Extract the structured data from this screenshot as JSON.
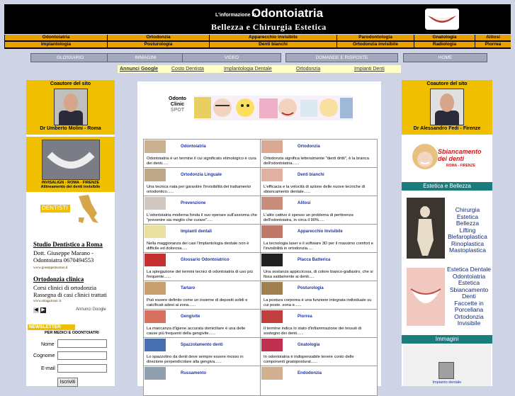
{
  "header": {
    "intro": "L'informazione in",
    "title": "Odontoiatria",
    "subtitle": "Bellezza e Chirurgia Estetica"
  },
  "nav_rows": [
    [
      "Odontoiatria",
      "Ortodonzia",
      "Apparecchio invisibile",
      "Parodontologia",
      "Gnatologia",
      "Alitosi"
    ],
    [
      "Implantologia",
      "Posturologia",
      "Denti bianchi",
      "Ortodonzia invisibile",
      "Radiologia",
      "Piorrea"
    ]
  ],
  "buttons": [
    "GLOSSARIO",
    "IMMAGINI",
    "VIDEO",
    "DOMANDE E RISPOSTE",
    "HOME"
  ],
  "ads": {
    "google": "Annunci Google",
    "links": [
      "Costo Dentista",
      "Implantologia Dentale",
      "Ortodonzia",
      "Impianti Denti"
    ]
  },
  "left": {
    "sponsor_title": "Coautore del sito",
    "sponsor_name": "Dr Umberto Molini - Roma",
    "invisalign_caption": "INVISALIGN - ROMA - FIRENZE\nAllineamento dei denti invisibile",
    "dentisti_label": "DENTISTI",
    "ad1_title": "Studio Dentistico a Roma",
    "ad1_text": "Dott. Giuseppe Marano - Odontoiatra 0670494553",
    "ad1_url": "www.giuseppemarano.it",
    "ad2_title": "Ortodonzia clinica",
    "ad2_text": "Corsi clinici di ortodonzia Rassegna di casi clinici trattati",
    "ad2_url": "www.smagalrosic.it",
    "google_ads": "Annunci Google",
    "newsletter": "NEWSLETTER",
    "newsletter_sub": "PER MEDICI E ODONTOIATRI",
    "field_labels": [
      "Nome",
      "Cognome",
      "E-mail"
    ],
    "submit": "Iscriviti"
  },
  "banner": {
    "word1": "Odonto",
    "word2": "Clinic",
    "word3": "SPOT"
  },
  "cards": [
    {
      "title": "Odontoiatria",
      "text": "Odontoiatria è un termine il cui significato etimologico è cura dei denti.....",
      "thumb": "#c9b08e"
    },
    {
      "title": "Ortodonzia",
      "text": "Ortodonzia significa letteralmente \"denti dritti\", è la branca dell'odontoiatria......",
      "thumb": "#d8a890"
    },
    {
      "title": "Ortodonzia Linguale",
      "text": "Una tecnica nata per garantire l'invisibilità del trattamento ortodontico......",
      "thumb": "#bfa88a"
    },
    {
      "title": "Denti bianchi",
      "text": "L'efficacia e la velocità di azione delle nuove tecniche di sbiancamento dentale......",
      "thumb": "#e0b0a0"
    },
    {
      "title": "Prevenzione",
      "text": "L'odontoiatria moderna fonda il suo operare sull'assioma che \"prevenire sia meglio che curare\".....",
      "thumb": "#d0c8c0"
    },
    {
      "title": "Alitosi",
      "text": "L'alito cattivo è spesso un problema di pertinenza dell'odontoiatra, in circa il 90%.....",
      "thumb": "#c88c7a"
    },
    {
      "title": "Impianti dentali",
      "text": "Nella maggioranza dei casi l'implantologia dentale non è difficile ed dolorosa.....",
      "thumb": "#e8e0a0"
    },
    {
      "title": "Apparecchio Invisibile",
      "text": "La tecnologia laser e il software 3D per il massimo comfort e l'invisibilità in ortodonzia.....",
      "thumb": "#c07868"
    },
    {
      "title": "Glossario Odontoiatrico",
      "text": "La spiegazione dei termini tecnici di odontoiatria di uso più frequente......",
      "thumb": "#c43030"
    },
    {
      "title": "Placca Batterica",
      "text": "Una sostanza appiccicosa, di colore bianco-giallastro, che si fissa saldamente ai denti.....",
      "thumb": "#202020"
    },
    {
      "title": "Tartaro",
      "text": "Può essere definito come un insieme di depositi solidi e calcificati adesi ai zona......",
      "thumb": "#c8a070"
    },
    {
      "title": "Posturologia",
      "text": "La postura corporea è una funzione integrata individuale su cui poste. sona e......",
      "thumb": "#a08050"
    },
    {
      "title": "Gengivite",
      "text": "La mancanza d'igiene accurata domiciliare è una delle cause più frequenti della gengivite......",
      "thumb": "#d87060"
    },
    {
      "title": "Piorrea",
      "text": "Il termine indica lo stato d'infiammazione dei tessuti di sostegno dei denti......",
      "thumb": "#c04040"
    },
    {
      "title": "Spazzolamento denti",
      "text": "Lo spazzolino da denti deve sempre essere mosso in direzione perpendicolare alla gengiva......",
      "thumb": "#4870b0"
    },
    {
      "title": "Gnatologia",
      "text": "In odontoiatria è indispensabile tenere conto delle componenti gnatopostural......",
      "thumb": "#c03050"
    },
    {
      "title": "Russamento",
      "text": "",
      "thumb": "#90a0b0"
    },
    {
      "title": "Endodonzia",
      "text": "",
      "thumb": "#d0b090"
    }
  ],
  "right": {
    "sponsor_title": "Coautore del sito",
    "sponsor_name": "Dr Alessandro Fedi - Firenze",
    "sbianc_title": "Sbiancamento\ndei denti",
    "sbianc_sub": "ROMA - FIRENZE",
    "section1": "Estetica e Bellezza",
    "list1": [
      "Chirurgia",
      "Estetica",
      "Bellezza",
      "Lifting",
      "Blefaroplastica",
      "Rinoplastica",
      "Mastoplastica"
    ],
    "list2": [
      "Estetica Dentale",
      "Odontoiatria",
      "Estetica",
      "Sbiancamento",
      "Denti",
      "Faccette in",
      "Porcellana",
      "Ortodonzia",
      "Invisibile"
    ],
    "section2": "Immagini",
    "img_caption": "Impianto dentale"
  }
}
